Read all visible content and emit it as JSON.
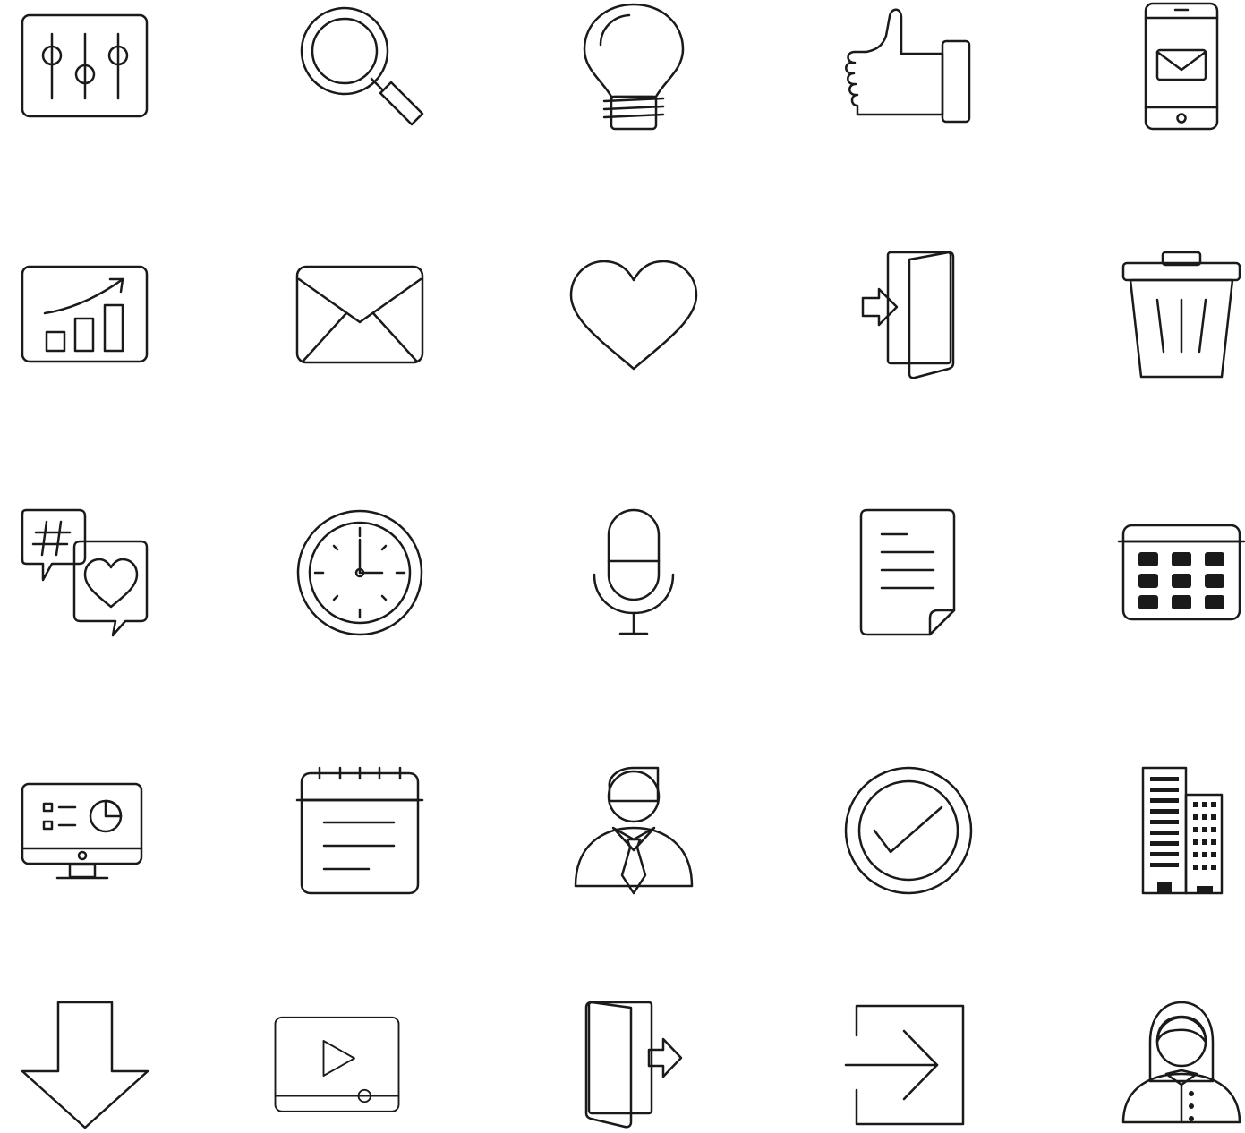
{
  "colors": {
    "ink": "#1a1a1a",
    "red": "#e94e35",
    "blue": "#04269a",
    "paper": "#ffffff"
  },
  "icons": [
    {
      "row": 1,
      "col": 1,
      "name": "sliders-icon"
    },
    {
      "row": 1,
      "col": 2,
      "name": "magnifier-icon"
    },
    {
      "row": 1,
      "col": 3,
      "name": "lightbulb-icon"
    },
    {
      "row": 1,
      "col": 4,
      "name": "thumbs-up-icon"
    },
    {
      "row": 1,
      "col": 5,
      "name": "phone-mail-icon"
    },
    {
      "row": 2,
      "col": 1,
      "name": "growth-chart-icon"
    },
    {
      "row": 2,
      "col": 2,
      "name": "envelope-icon"
    },
    {
      "row": 2,
      "col": 3,
      "name": "heart-icon"
    },
    {
      "row": 2,
      "col": 4,
      "name": "door-enter-icon"
    },
    {
      "row": 2,
      "col": 5,
      "name": "trash-icon"
    },
    {
      "row": 3,
      "col": 1,
      "name": "hashtag-chat-icon"
    },
    {
      "row": 3,
      "col": 2,
      "name": "clock-icon"
    },
    {
      "row": 3,
      "col": 3,
      "name": "microphone-icon"
    },
    {
      "row": 3,
      "col": 4,
      "name": "document-icon"
    },
    {
      "row": 3,
      "col": 5,
      "name": "calendar-grid-icon"
    },
    {
      "row": 4,
      "col": 1,
      "name": "monitor-dashboard-icon"
    },
    {
      "row": 4,
      "col": 2,
      "name": "notepad-icon"
    },
    {
      "row": 4,
      "col": 3,
      "name": "businessman-icon"
    },
    {
      "row": 4,
      "col": 4,
      "name": "check-circle-icon"
    },
    {
      "row": 4,
      "col": 5,
      "name": "buildings-icon"
    },
    {
      "row": 5,
      "col": 1,
      "name": "download-arrow-icon"
    },
    {
      "row": 5,
      "col": 2,
      "name": "video-player-icon"
    },
    {
      "row": 5,
      "col": 3,
      "name": "door-exit-icon"
    },
    {
      "row": 5,
      "col": 4,
      "name": "sign-in-icon"
    },
    {
      "row": 5,
      "col": 5,
      "name": "businesswoman-icon"
    }
  ]
}
